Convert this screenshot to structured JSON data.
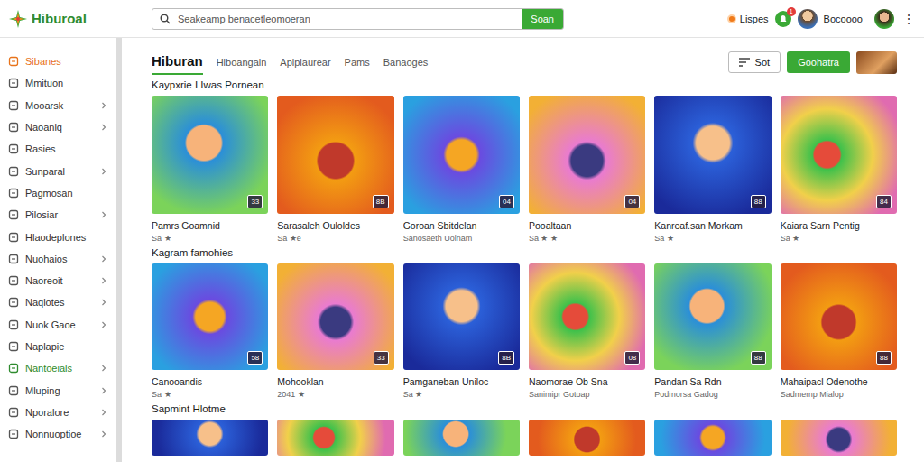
{
  "logo": {
    "text": "Hiburoal"
  },
  "search": {
    "placeholder": "Seakeamp benacetleomoeran",
    "button": "Soan"
  },
  "user": {
    "status": "Lispes",
    "notifications": "1",
    "name": "Bocoooo",
    "menu": "⋮"
  },
  "sidebar": {
    "items": [
      {
        "label": "Sibanes",
        "selected": true,
        "highlighted": false,
        "expandable": false
      },
      {
        "label": "Mmituon",
        "selected": false,
        "highlighted": false,
        "expandable": false
      },
      {
        "label": "Mooarsk",
        "selected": false,
        "highlighted": false,
        "expandable": true
      },
      {
        "label": "Naoaniq",
        "selected": false,
        "highlighted": false,
        "expandable": true
      },
      {
        "label": "Rasies",
        "selected": false,
        "highlighted": false,
        "expandable": false
      },
      {
        "label": "Sunparal",
        "selected": false,
        "highlighted": false,
        "expandable": true
      },
      {
        "label": "Pagmosan",
        "selected": false,
        "highlighted": false,
        "expandable": false
      },
      {
        "label": "Pilosiar",
        "selected": false,
        "highlighted": false,
        "expandable": true
      },
      {
        "label": "Hlaodeplones",
        "selected": false,
        "highlighted": false,
        "expandable": false
      },
      {
        "label": "Nuohaios",
        "selected": false,
        "highlighted": false,
        "expandable": true
      },
      {
        "label": "Naoreoit",
        "selected": false,
        "highlighted": false,
        "expandable": true
      },
      {
        "label": "Naqlotes",
        "selected": false,
        "highlighted": false,
        "expandable": true
      },
      {
        "label": "Nuok Gaoe",
        "selected": false,
        "highlighted": false,
        "expandable": true
      },
      {
        "label": "Naplapie",
        "selected": false,
        "highlighted": false,
        "expandable": false
      },
      {
        "label": "Nantoeials",
        "selected": false,
        "highlighted": true,
        "expandable": true
      },
      {
        "label": "Mluping",
        "selected": false,
        "highlighted": false,
        "expandable": true
      },
      {
        "label": "Nporalore",
        "selected": false,
        "highlighted": false,
        "expandable": true
      },
      {
        "label": "Nonnuoptioe",
        "selected": false,
        "highlighted": false,
        "expandable": true
      }
    ]
  },
  "tabs": [
    {
      "label": "Hiburan",
      "selected": true
    },
    {
      "label": "Hiboangain",
      "selected": false
    },
    {
      "label": "Apiplaurear",
      "selected": false
    },
    {
      "label": "Pams",
      "selected": false
    },
    {
      "label": "Banaoges",
      "selected": false
    }
  ],
  "toolbar": {
    "sort": "Sot",
    "primary": "Goohatra"
  },
  "sections": [
    {
      "title": "Kaypxrie I Iwas Pornean",
      "cards": [
        {
          "title": "Pamrs Goamnid",
          "subtitle": "Sa ★",
          "badge": "33"
        },
        {
          "title": "Sarasaleh Ouloldes",
          "subtitle": "Sa ★e",
          "badge": "8B"
        },
        {
          "title": "Goroan Sbitdelan",
          "subtitle": "Sanosaeth Uolnam",
          "badge": "04"
        },
        {
          "title": "Pooaltaan",
          "subtitle": "Sa ★ ★",
          "badge": "04"
        },
        {
          "title": "Kanreaf.san Morkam",
          "subtitle": "Sa ★",
          "badge": "88"
        },
        {
          "title": "Kaiara Sarn Pentig",
          "subtitle": "Sa ★",
          "badge": "84"
        }
      ]
    },
    {
      "title": "Kagram famohies",
      "cards": [
        {
          "title": "Canooandis",
          "subtitle": "Sa ★",
          "badge": "58"
        },
        {
          "title": "Mohooklan",
          "subtitle": "2041 ★",
          "badge": "33"
        },
        {
          "title": "Pamganeban Uniloc",
          "subtitle": "Sa ★",
          "badge": "8B"
        },
        {
          "title": "Naomorae Ob Sna",
          "subtitle": "Sanimipr Gotoap",
          "badge": "08"
        },
        {
          "title": "Pandan Sa Rdn",
          "subtitle": "Podmorsa Gadog",
          "badge": "88"
        },
        {
          "title": "Mahaipacl Odenothe",
          "subtitle": "Sadmemp Mialop",
          "badge": "88"
        }
      ]
    },
    {
      "title": "Sapmint Hlotme",
      "cards": [
        {},
        {},
        {},
        {},
        {},
        {}
      ]
    }
  ]
}
